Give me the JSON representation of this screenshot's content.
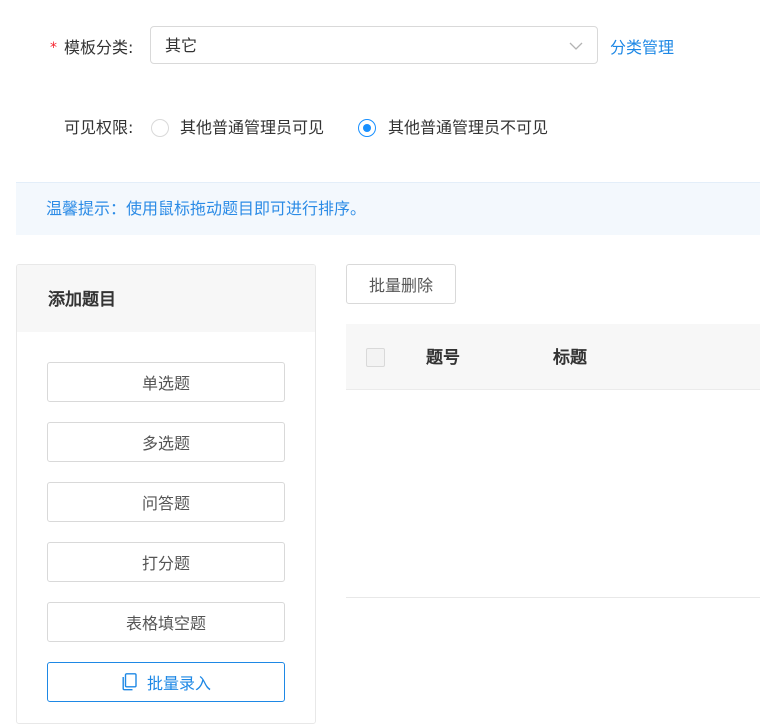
{
  "form": {
    "required_mark": "*",
    "category_label": "模板分类:",
    "category_value": "其它",
    "category_manage_link": "分类管理",
    "visibility_label": "可见权限:",
    "visibility_options": [
      {
        "label": "其他普通管理员可见",
        "checked": false
      },
      {
        "label": "其他普通管理员不可见",
        "checked": true
      }
    ]
  },
  "tip": {
    "text": "温馨提示：使用鼠标拖动题目即可进行排序。"
  },
  "add_panel": {
    "title": "添加题目",
    "buttons": [
      "单选题",
      "多选题",
      "问答题",
      "打分题",
      "表格填空题"
    ],
    "batch_input_label": "批量录入"
  },
  "table": {
    "batch_delete_label": "批量删除",
    "columns": [
      "题号",
      "标题"
    ]
  },
  "colors": {
    "accent": "#1e88e5",
    "tip_background": "#f3f8fd",
    "required": "#f5222d"
  }
}
